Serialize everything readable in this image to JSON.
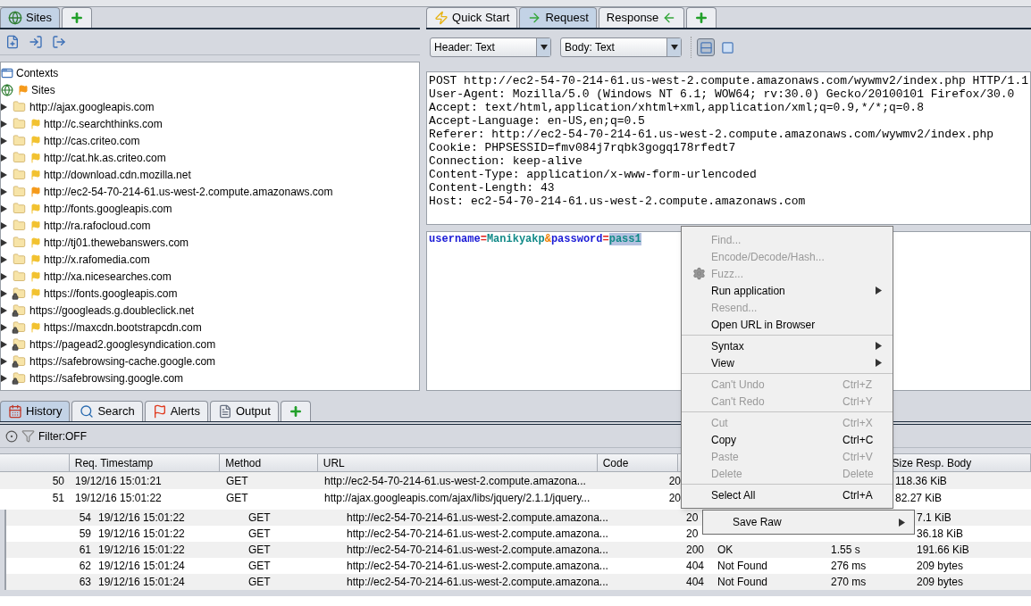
{
  "sites_panel": {
    "tabs": [
      {
        "kind": "sites",
        "label": "Sites",
        "selected": true
      },
      {
        "kind": "add",
        "selected": false
      }
    ],
    "tree": [
      {
        "kind": "contexts",
        "label": "Contexts"
      },
      {
        "kind": "sites",
        "label": "Sites",
        "flag": true,
        "color": "#f59a1b",
        "children": [
          {
            "label": "http://ajax.googleapis.com",
            "expanded": false,
            "flag": false,
            "secure": false
          },
          {
            "label": "http://c.searchthinks.com",
            "expanded": false,
            "flag": true,
            "color": "#f2c230",
            "secure": false
          },
          {
            "label": "http://cas.criteo.com",
            "expanded": false,
            "flag": true,
            "color": "#f2c230",
            "secure": false
          },
          {
            "label": "http://cat.hk.as.criteo.com",
            "expanded": false,
            "flag": true,
            "color": "#f2c230",
            "secure": false
          },
          {
            "label": "http://download.cdn.mozilla.net",
            "expanded": false,
            "flag": true,
            "color": "#f2c230",
            "secure": false
          },
          {
            "label": "http://ec2-54-70-214-61.us-west-2.compute.amazonaws.com",
            "expanded": false,
            "flag": true,
            "color": "#f59a1b",
            "secure": false
          },
          {
            "label": "http://fonts.googleapis.com",
            "expanded": false,
            "flag": true,
            "color": "#f2c230",
            "secure": false
          },
          {
            "label": "http://ra.rafocloud.com",
            "expanded": false,
            "flag": true,
            "color": "#f2c230",
            "secure": false
          },
          {
            "label": "http://tj01.thewebanswers.com",
            "expanded": false,
            "flag": true,
            "color": "#f2c230",
            "secure": false
          },
          {
            "label": "http://x.rafomedia.com",
            "expanded": false,
            "flag": true,
            "color": "#f2c230",
            "secure": false
          },
          {
            "label": "http://xa.nicesearches.com",
            "expanded": false,
            "flag": true,
            "color": "#f2c230",
            "secure": false
          },
          {
            "label": "https://fonts.googleapis.com",
            "expanded": false,
            "flag": true,
            "color": "#f2c230",
            "secure": true
          },
          {
            "label": "https://googleads.g.doubleclick.net",
            "expanded": false,
            "flag": false,
            "secure": true
          },
          {
            "label": "https://maxcdn.bootstrapcdn.com",
            "expanded": false,
            "flag": true,
            "color": "#f2c230",
            "secure": true
          },
          {
            "label": "https://pagead2.googlesyndication.com",
            "expanded": false,
            "flag": false,
            "secure": true
          },
          {
            "label": "https://safebrowsing-cache.google.com",
            "expanded": false,
            "flag": false,
            "secure": true
          },
          {
            "label": "https://safebrowsing.google.com",
            "expanded": false,
            "flag": false,
            "secure": true
          }
        ]
      }
    ]
  },
  "request_panel": {
    "tabs": [
      {
        "kind": "quick-start",
        "label": "Quick Start",
        "selected": false
      },
      {
        "kind": "request",
        "label": "Request",
        "selected": true
      },
      {
        "kind": "response",
        "label": "Response",
        "selected": false
      },
      {
        "kind": "add",
        "selected": false
      }
    ],
    "selects": [
      {
        "value": "Header: Text"
      },
      {
        "value": "Body: Text"
      }
    ],
    "view_buttons": [
      {
        "kind": "split",
        "selected": true
      },
      {
        "kind": "single",
        "selected": false
      }
    ],
    "header_lines": [
      "POST http://ec2-54-70-214-61.us-west-2.compute.amazonaws.com/wywmv2/index.php HTTP/1.1",
      "User-Agent: Mozilla/5.0 (Windows NT 6.1; WOW64; rv:30.0) Gecko/20100101 Firefox/30.0",
      "Accept: text/html,application/xhtml+xml,application/xml;q=0.9,*/*;q=0.8",
      "Accept-Language: en-US,en;q=0.5",
      "Referer: http://ec2-54-70-214-61.us-west-2.compute.amazonaws.com/wywmv2/index.php",
      "Cookie: PHPSESSID=fmv084j7rqbk3gogq178rfedt7",
      "Connection: keep-alive",
      "Content-Type: application/x-www-form-urlencoded",
      "Content-Length: 43",
      "Host: ec2-54-70-214-61.us-west-2.compute.amazonaws.com"
    ],
    "body_tokens": [
      {
        "text": "username",
        "kind": "key",
        "selected": false
      },
      {
        "text": "=",
        "kind": "operator",
        "selected": false
      },
      {
        "text": "Manikyakp",
        "kind": "value",
        "selected": false
      },
      {
        "text": "&",
        "kind": "separator",
        "selected": false
      },
      {
        "text": "password",
        "kind": "key",
        "selected": false
      },
      {
        "text": "=",
        "kind": "operator",
        "selected": false
      },
      {
        "text": "pass1",
        "kind": "value",
        "selected": true
      }
    ]
  },
  "bottom_panel": {
    "tabs": [
      {
        "kind": "history",
        "label": "History",
        "selected": true
      },
      {
        "kind": "search",
        "label": "Search",
        "selected": false
      },
      {
        "kind": "alerts",
        "label": "Alerts",
        "selected": false
      },
      {
        "kind": "output",
        "label": "Output",
        "selected": false
      },
      {
        "kind": "add",
        "selected": false
      }
    ],
    "filter": "Filter:OFF",
    "table": {
      "columns": [
        "Req. Timestamp",
        "Method",
        "URL",
        "Code",
        "Size Resp. Body"
      ],
      "rows": [
        {
          "id": "50",
          "timestamp": "19/12/16 15:01:21",
          "method": "GET",
          "url": "http://ec2-54-70-214-61.us-west-2.compute.amazona...",
          "code": "20",
          "size": "118.36 KiB"
        },
        {
          "id": "51",
          "timestamp": "19/12/16 15:01:22",
          "method": "GET",
          "url": "http://ajax.googleapis.com/ajax/libs/jquery/2.1.1/jquery...",
          "code": "20",
          "size": "82.27 KiB"
        }
      ]
    },
    "dragged_rows": [
      {
        "id": "54",
        "timestamp": "19/12/16 15:01:22",
        "method": "GET",
        "url": "http://ec2-54-70-214-61.us-west-2.compute.amazona...",
        "code": "20",
        "size": "7.1 KiB"
      },
      {
        "id": "59",
        "timestamp": "19/12/16 15:01:22",
        "method": "GET",
        "url": "http://ec2-54-70-214-61.us-west-2.compute.amazona...",
        "code": "20",
        "size": "36.18 KiB"
      },
      {
        "id": "61",
        "timestamp": "19/12/16 15:01:22",
        "method": "GET",
        "url": "http://ec2-54-70-214-61.us-west-2.compute.amazona...",
        "code": "200",
        "status": "OK",
        "time": "1.55 s",
        "size": "191.66 KiB"
      },
      {
        "id": "62",
        "timestamp": "19/12/16 15:01:24",
        "method": "GET",
        "url": "http://ec2-54-70-214-61.us-west-2.compute.amazona...",
        "code": "404",
        "status": "Not Found",
        "time": "276 ms",
        "size": "209 bytes"
      },
      {
        "id": "63",
        "timestamp": "19/12/16 15:01:24",
        "method": "GET",
        "url": "http://ec2-54-70-214-61.us-west-2.compute.amazona...",
        "code": "404",
        "status": "Not Found",
        "time": "270 ms",
        "size": "209 bytes"
      }
    ]
  },
  "context_menu": [
    {
      "kind": "item",
      "label": "Find...",
      "disabled": true,
      "submenu": false
    },
    {
      "kind": "item",
      "label": "Encode/Decode/Hash...",
      "disabled": true,
      "submenu": false
    },
    {
      "kind": "item-with-icon",
      "label": "Fuzz...",
      "disabled": true,
      "submenu": false
    },
    {
      "kind": "item",
      "label": "Run application",
      "disabled": false,
      "submenu": true
    },
    {
      "kind": "item",
      "label": "Resend...",
      "disabled": true,
      "submenu": false
    },
    {
      "kind": "item",
      "label": "Open URL in Browser",
      "disabled": false,
      "submenu": false
    },
    {
      "kind": "separator"
    },
    {
      "kind": "item",
      "label": "Syntax",
      "disabled": false,
      "submenu": true
    },
    {
      "kind": "item",
      "label": "View",
      "disabled": false,
      "submenu": true
    },
    {
      "kind": "separator"
    },
    {
      "kind": "item",
      "label": "Can't Undo",
      "shortcut": "Ctrl+Z",
      "disabled": true,
      "submenu": false
    },
    {
      "kind": "item",
      "label": "Can't Redo",
      "shortcut": "Ctrl+Y",
      "disabled": true,
      "submenu": false
    },
    {
      "kind": "separator"
    },
    {
      "kind": "item",
      "label": "Cut",
      "shortcut": "Ctrl+X",
      "disabled": true,
      "submenu": false
    },
    {
      "kind": "item",
      "label": "Copy",
      "shortcut": "Ctrl+C",
      "disabled": false,
      "submenu": false
    },
    {
      "kind": "item",
      "label": "Paste",
      "shortcut": "Ctrl+V",
      "disabled": true,
      "submenu": false
    },
    {
      "kind": "item",
      "label": "Delete",
      "shortcut": "Delete",
      "disabled": true,
      "submenu": false
    },
    {
      "kind": "separator"
    },
    {
      "kind": "item",
      "label": "Select All",
      "shortcut": "Ctrl+A",
      "disabled": false,
      "submenu": false
    }
  ],
  "drag_menu": [
    {
      "label": "Save Raw",
      "submenu": true
    }
  ]
}
